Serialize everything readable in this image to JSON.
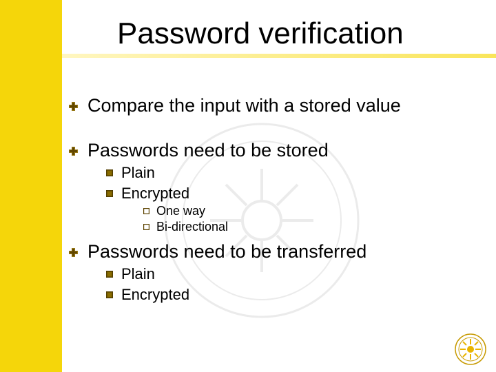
{
  "slide": {
    "title": "Password verification",
    "bullets": [
      {
        "level": 1,
        "text": "Compare the input with a stored value"
      },
      {
        "level": 1,
        "text": "Passwords need to be stored"
      },
      {
        "level": 2,
        "text": "Plain"
      },
      {
        "level": 2,
        "text": "Encrypted"
      },
      {
        "level": 3,
        "text": "One way"
      },
      {
        "level": 3,
        "text": "Bi-directional"
      },
      {
        "level": 1,
        "text": "Passwords need to be transferred"
      },
      {
        "level": 2,
        "text": "Plain"
      },
      {
        "level": 2,
        "text": "Encrypted"
      }
    ]
  },
  "theme": {
    "accent": "#f5d60a",
    "bullet_color": "#614600"
  }
}
